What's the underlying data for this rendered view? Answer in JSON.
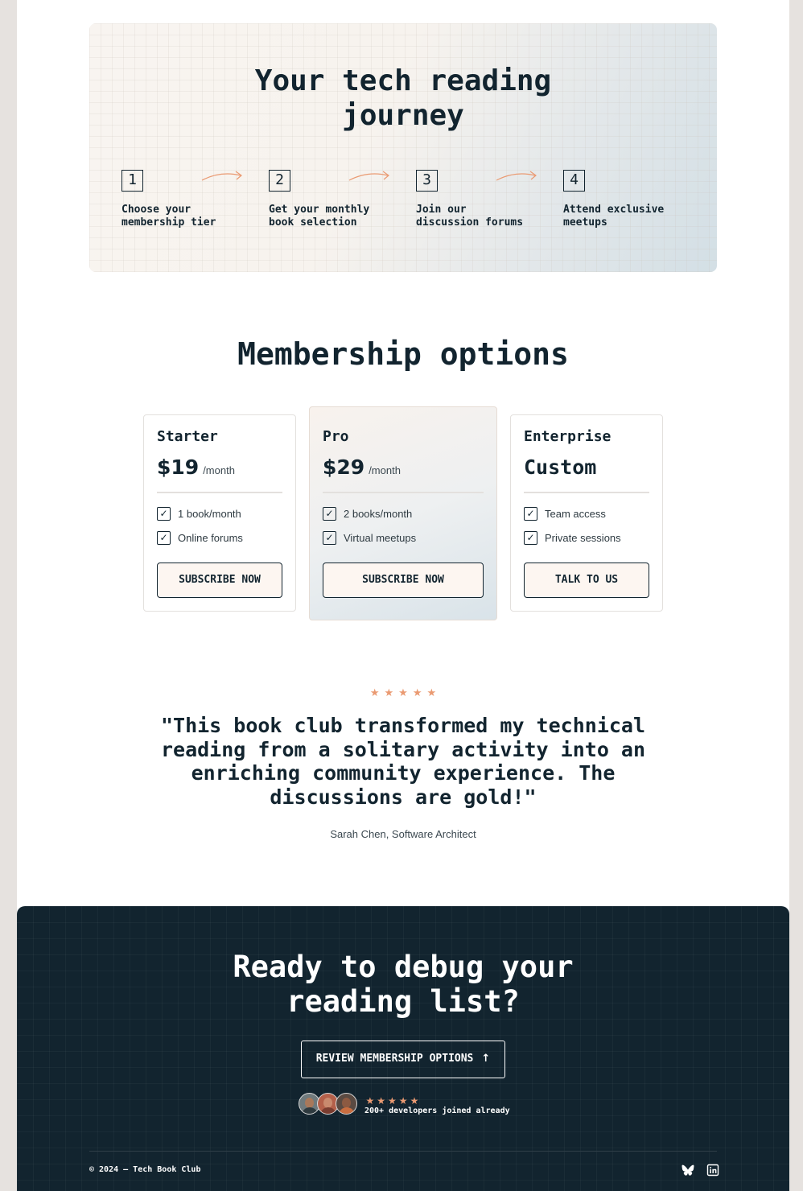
{
  "journey": {
    "title": "Your tech reading journey",
    "steps": [
      {
        "number": "1",
        "label": "Choose your membership tier"
      },
      {
        "number": "2",
        "label": "Get your monthly book selection"
      },
      {
        "number": "3",
        "label": "Join our discussion forums"
      },
      {
        "number": "4",
        "label": "Attend exclusive meetups"
      }
    ]
  },
  "membership": {
    "title": "Membership options",
    "plans": [
      {
        "name": "Starter",
        "price": "$19",
        "period": "/month",
        "features": [
          "1 book/month",
          "Online forums"
        ],
        "button": "SUBSCRIBE NOW"
      },
      {
        "name": "Pro",
        "price": "$29",
        "period": "/month",
        "features": [
          "2 books/month",
          "Virtual meetups"
        ],
        "button": "SUBSCRIBE NOW"
      },
      {
        "name": "Enterprise",
        "price": "Custom",
        "period": "",
        "features": [
          "Team access",
          "Private sessions"
        ],
        "button": "TALK TO US"
      }
    ]
  },
  "testimonial": {
    "rating": 5,
    "quote": "\"This book club transformed my technical reading from a solitary activity into an enriching community experience. The discussions are gold!\"",
    "author": "Sarah Chen, Software Architect"
  },
  "cta": {
    "title": "Ready to debug your reading list?",
    "button": "REVIEW MEMBERSHIP OPTIONS",
    "rating": 5,
    "joined_text": "200+ developers joined already"
  },
  "footer": {
    "copyright": "© 2024 — Tech Book Club",
    "social_icons": [
      "bluesky-icon",
      "linkedin-icon"
    ]
  },
  "colors": {
    "dark": "#12242f",
    "accent": "#ea9a72",
    "button_bg": "#fdf6f1"
  }
}
